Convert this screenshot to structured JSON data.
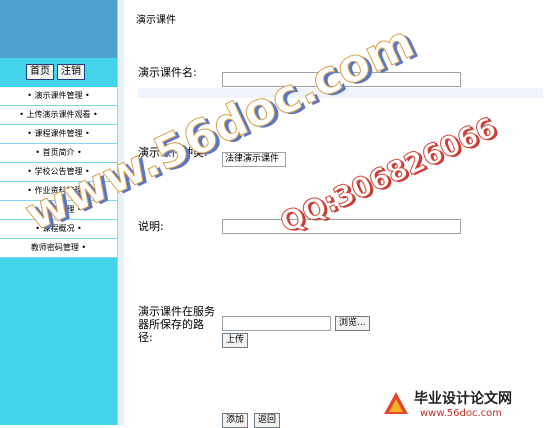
{
  "sidebar": {
    "home_label": "首页",
    "logout_label": "注销",
    "items": [
      {
        "label": "• 演示课件管理 •"
      },
      {
        "label": "• 上传演示课件观看 •"
      },
      {
        "label": "• 课程课件管理 •"
      },
      {
        "label": "• 首页简介 •"
      },
      {
        "label": "• 学校公告管理 •"
      },
      {
        "label": "• 作业资料管理 •"
      },
      {
        "label": "• 留言管理 •"
      },
      {
        "label": "• 课程概况 •"
      },
      {
        "label": "教师密码管理 •"
      }
    ]
  },
  "main": {
    "title": "演示课件",
    "form": {
      "name_label": "演示课件名:",
      "name_value": "",
      "type_label": "演示课件种类:",
      "type_value": "法律演示课件",
      "desc_label": "说明:",
      "desc_value": "",
      "path_label": "演示课件在服务器所保存的路径:",
      "path_value": "",
      "browse_label": "浏览...",
      "upload_label": "上传",
      "add_label": "添加",
      "back_label": "返回"
    }
  },
  "watermarks": {
    "site": "www.56doc.com",
    "qq": "QQ:306826066",
    "brand_main": "毕业设计论文网",
    "brand_url": "www.56doc.com"
  }
}
